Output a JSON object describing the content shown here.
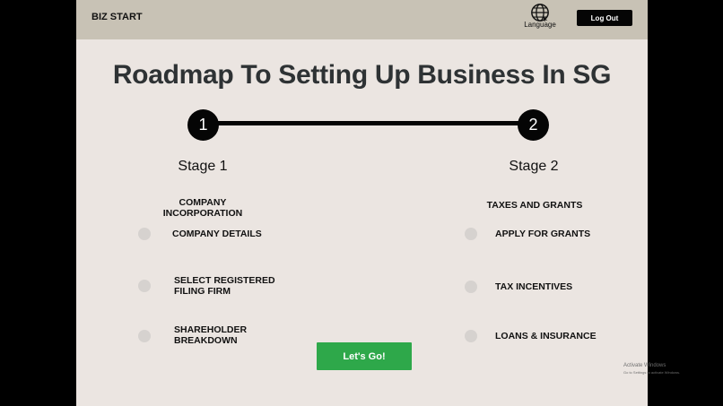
{
  "header": {
    "brand": "BIZ START",
    "language_label": "Language",
    "logout_label": "Log Out"
  },
  "main": {
    "title": "Roadmap To Setting Up Business In SG",
    "stages": [
      {
        "number": "1",
        "label": "Stage 1",
        "heading": "COMPANY INCORPORATION",
        "items": [
          "COMPANY DETAILS",
          "SELECT REGISTERED FILING FIRM",
          "SHAREHOLDER BREAKDOWN"
        ]
      },
      {
        "number": "2",
        "label": "Stage 2",
        "heading": "TAXES AND GRANTS",
        "items": [
          "APPLY FOR GRANTS",
          "TAX INCENTIVES",
          "LOANS & INSURANCE"
        ]
      }
    ],
    "cta_label": "Let's Go!"
  },
  "watermark": {
    "line1": "Activate Windows",
    "line2": "Go to Settings to activate Windows."
  },
  "colors": {
    "page_bg": "#ebe5e1",
    "header_bg": "#c8c2b5",
    "accent_green": "#2ea84a",
    "dark": "#050505"
  },
  "icons": {
    "language": "globe-icon"
  }
}
